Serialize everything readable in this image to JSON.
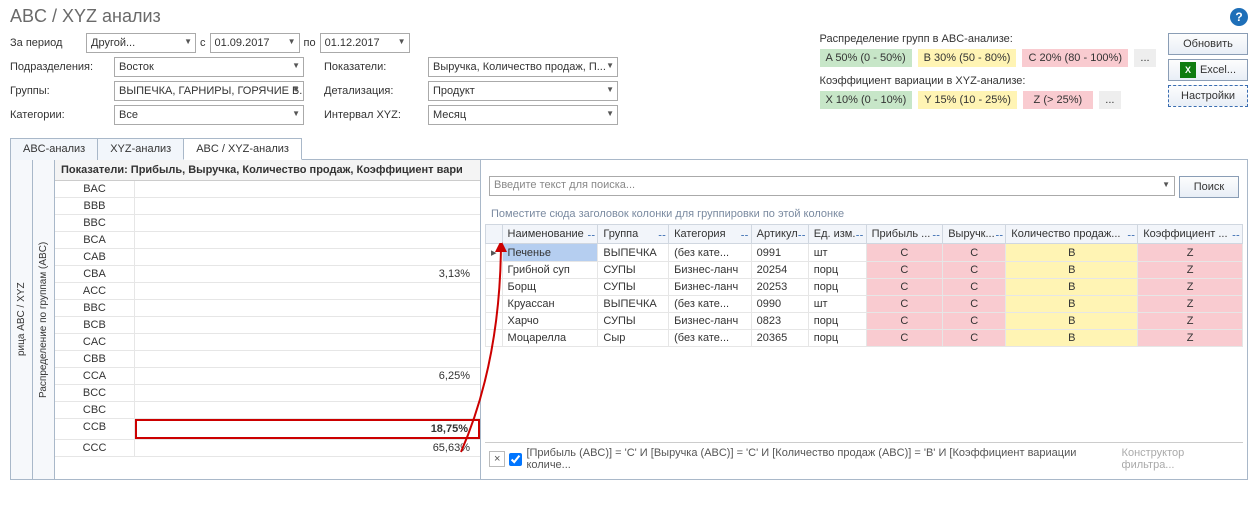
{
  "header": {
    "title": "ABC / XYZ анализ"
  },
  "filters": {
    "period_label": "За период",
    "period_value": "Другой...",
    "from_label": "с",
    "from_value": "01.09.2017",
    "to_label": "по",
    "to_value": "01.12.2017",
    "division_label": "Подразделения:",
    "division_value": "Восток",
    "metrics_label": "Показатели:",
    "metrics_value": "Выручка, Количество продаж, П...",
    "groups_label": "Группы:",
    "groups_value": "ВЫПЕЧКА, ГАРНИРЫ, ГОРЯЧИЕ Б...",
    "detail_label": "Детализация:",
    "detail_value": "Продукт",
    "categories_label": "Категории:",
    "categories_value": "Все",
    "interval_label": "Интервал XYZ:",
    "interval_value": "Месяц"
  },
  "legend": {
    "abc_label": "Распределение групп в ABC-анализе:",
    "abc": [
      {
        "text": "A 50% (0 - 50%)",
        "cls": "bg-a"
      },
      {
        "text": "B 30% (50 - 80%)",
        "cls": "bg-b"
      },
      {
        "text": "C 20% (80 - 100%)",
        "cls": "bg-c"
      }
    ],
    "xyz_label": "Коэффициент вариации в XYZ-анализе:",
    "xyz": [
      {
        "text": "X 10% (0 - 10%)",
        "cls": "bg-a"
      },
      {
        "text": "Y 15% (10 - 25%)",
        "cls": "bg-b"
      },
      {
        "text": "Z    (> 25%)",
        "cls": "bg-c"
      }
    ],
    "more": "..."
  },
  "buttons": {
    "refresh": "Обновить",
    "excel": "Excel...",
    "settings": "Настройки"
  },
  "tabs": [
    {
      "label": "ABC-анализ"
    },
    {
      "label": "XYZ-анализ"
    },
    {
      "label": "ABC / XYZ-анализ",
      "active": true
    }
  ],
  "left": {
    "vtab1": "Распределение по группам (ABC)",
    "vtab2": "рица ABC / XYZ",
    "header": "Показатели: Прибыль, Выручка, Количество продаж, Коэффициент вари",
    "rows": [
      {
        "code": "BAC",
        "val": ""
      },
      {
        "code": "BBB",
        "val": ""
      },
      {
        "code": "BBC",
        "val": ""
      },
      {
        "code": "BCA",
        "val": ""
      },
      {
        "code": "CAB",
        "val": ""
      },
      {
        "code": "CBA",
        "val": "3,13%"
      },
      {
        "code": "ACC",
        "val": ""
      },
      {
        "code": "BBC",
        "val": ""
      },
      {
        "code": "BCB",
        "val": ""
      },
      {
        "code": "CAC",
        "val": ""
      },
      {
        "code": "CBB",
        "val": ""
      },
      {
        "code": "CCA",
        "val": "6,25%"
      },
      {
        "code": "BCC",
        "val": ""
      },
      {
        "code": "CBC",
        "val": ""
      },
      {
        "code": "CCB",
        "val": "18,75%",
        "highlight": true
      },
      {
        "code": "CCC",
        "val": "65,63%"
      }
    ]
  },
  "right": {
    "search_placeholder": "Введите текст для поиска...",
    "search_btn": "Поиск",
    "group_hint": "Поместите сюда заголовок колонки для группировки по этой колонке",
    "columns": [
      "Наименование",
      "Группа",
      "Категория",
      "Артикул",
      "Ед. изм.",
      "Прибыль ...",
      "Выручк...",
      "Количество продаж...",
      "Коэффициент ..."
    ],
    "rows": [
      {
        "sel": true,
        "name": "Печенье",
        "group": "ВЫПЕЧКА",
        "cat": "(без кате...",
        "art": "0991",
        "unit": "шт",
        "p": "C",
        "r": "C",
        "q": "B",
        "k": "Z"
      },
      {
        "name": "Грибной суп",
        "group": "СУПЫ",
        "cat": "Бизнес-ланч",
        "art": "20254",
        "unit": "порц",
        "p": "C",
        "r": "C",
        "q": "B",
        "k": "Z"
      },
      {
        "name": "Борщ",
        "group": "СУПЫ",
        "cat": "Бизнес-ланч",
        "art": "20253",
        "unit": "порц",
        "p": "C",
        "r": "C",
        "q": "B",
        "k": "Z"
      },
      {
        "name": "Круассан",
        "group": "ВЫПЕЧКА",
        "cat": "(без кате...",
        "art": "0990",
        "unit": "шт",
        "p": "C",
        "r": "C",
        "q": "B",
        "k": "Z"
      },
      {
        "name": "Харчо",
        "group": "СУПЫ",
        "cat": "Бизнес-ланч",
        "art": "0823",
        "unit": "порц",
        "p": "C",
        "r": "C",
        "q": "B",
        "k": "Z"
      },
      {
        "name": "Моцарелла",
        "group": "Сыр",
        "cat": "(без кате...",
        "art": "20365",
        "unit": "порц",
        "p": "C",
        "r": "C",
        "q": "B",
        "k": "Z"
      }
    ],
    "footer_filter": "[Прибыль (ABC)] = 'C' И [Выручка (ABC)] = 'C' И [Количество продаж (ABC)] = 'B' И [Коэффициент вариации количе...",
    "footer_builder": "Конструктор фильтра..."
  }
}
